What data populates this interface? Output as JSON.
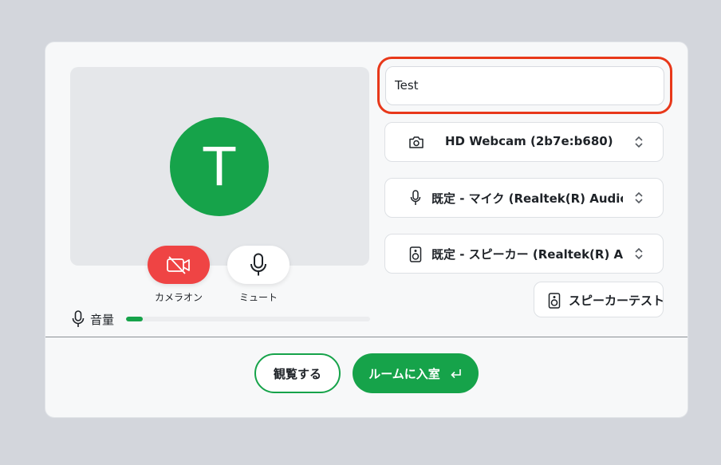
{
  "preview": {
    "avatar_letter": "T"
  },
  "controls": {
    "camera_label": "カメラオン",
    "mic_label": "ミュート"
  },
  "volume": {
    "label": "音量",
    "level": 0.07
  },
  "name_input": {
    "value": "Test"
  },
  "devices": {
    "camera": "HD Webcam (2b7e:b680)",
    "microphone": "既定 - マイク (Realtek(R) Audio)",
    "speaker": "既定 - スピーカー (Realtek(R) Audio)"
  },
  "speaker_test_label": "スピーカーテスト",
  "actions": {
    "watch_label": "観覧する",
    "join_label": "ルームに入室",
    "join_icon": "enter-return-icon"
  },
  "colors": {
    "accent": "#16a34a",
    "camera_off": "#ef4444",
    "highlight": "#e8381a"
  }
}
